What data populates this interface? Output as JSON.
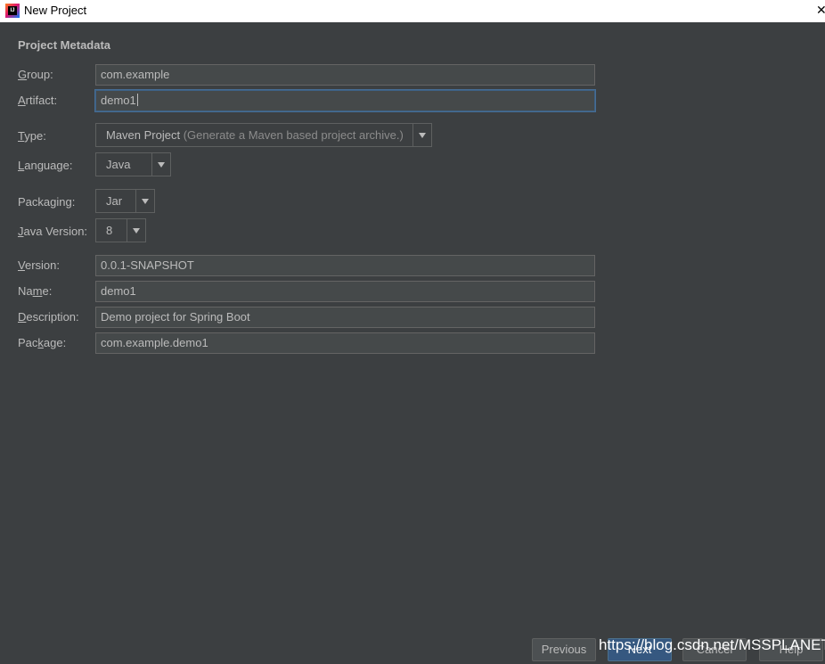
{
  "window": {
    "title": "New Project"
  },
  "section_title": "Project Metadata",
  "fields": {
    "group": {
      "label_ul": "G",
      "label_rest": "roup:",
      "value": "com.example"
    },
    "artifact": {
      "label_ul": "A",
      "label_rest": "rtifact:",
      "value": "demo1"
    },
    "version": {
      "label_ul": "V",
      "label_rest": "ersion:",
      "value": "0.0.1-SNAPSHOT"
    },
    "name": {
      "label_pre": "Na",
      "label_ul": "m",
      "label_rest": "e:",
      "value": "demo1"
    },
    "description": {
      "label_ul": "D",
      "label_rest": "escription:",
      "value": "Demo project for Spring Boot"
    },
    "package": {
      "label_pre": "Pac",
      "label_ul": "k",
      "label_rest": "age:",
      "value": "com.example.demo1"
    }
  },
  "combos": {
    "type": {
      "label_ul": "T",
      "label_rest": "ype:",
      "value": "Maven Project",
      "hint": "(Generate a Maven based project archive.)"
    },
    "language": {
      "label_ul": "L",
      "label_rest": "anguage:",
      "value": "Java"
    },
    "packaging": {
      "label_pre": "Packa",
      "label_ul": "g",
      "label_rest": "ing:",
      "value": "Jar"
    },
    "java_version": {
      "label_ul": "J",
      "label_rest": "ava Version:",
      "value": "8"
    }
  },
  "buttons": {
    "previous": "Previous",
    "next": "Next",
    "cancel": "Cancel",
    "help": "Help"
  },
  "watermark": "https://blog.csdn.net/MSSPLANET",
  "icons": {
    "app": "intellij-icon",
    "close": "close-icon",
    "dropdown": "chevron-down-icon"
  }
}
